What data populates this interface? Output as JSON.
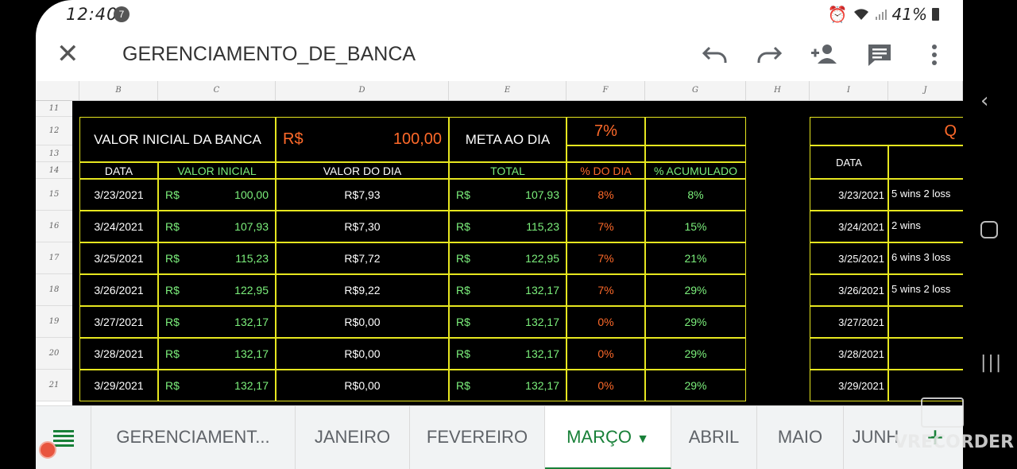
{
  "status": {
    "time": "12:40",
    "notif_count": "7",
    "battery": "41%"
  },
  "appbar": {
    "title": "GERENCIAMENTO_DE_BANCA"
  },
  "icons": {
    "close": "close-icon",
    "undo": "undo-icon",
    "redo": "redo-icon",
    "share": "add-person-icon",
    "comment": "comment-icon",
    "more": "more-vert-icon"
  },
  "columns": [
    "B",
    "C",
    "D",
    "E",
    "F",
    "G",
    "H",
    "I",
    "J"
  ],
  "rows": [
    "11",
    "12",
    "13",
    "14",
    "15",
    "16",
    "17",
    "18",
    "19",
    "20",
    "21"
  ],
  "summary": {
    "label": "VALOR INICIAL DA BANCA",
    "currency": "R$",
    "amount": "100,00",
    "meta_label": "META AO DIA",
    "meta_value": "7%"
  },
  "headers": {
    "data": "DATA",
    "valor_inicial": "VALOR INICIAL",
    "valor_dia": "VALOR DO DIA",
    "total": "TOTAL",
    "pct_dia": "% DO DIA",
    "pct_acum": "% ACUMULADO"
  },
  "table": [
    {
      "date": "3/23/2021",
      "cur": "R$",
      "inicial": "100,00",
      "dia": "R$7,93",
      "cur2": "R$",
      "total": "107,93",
      "pct": "8%",
      "acum": "8%"
    },
    {
      "date": "3/24/2021",
      "cur": "R$",
      "inicial": "107,93",
      "dia": "R$7,30",
      "cur2": "R$",
      "total": "115,23",
      "pct": "7%",
      "acum": "15%"
    },
    {
      "date": "3/25/2021",
      "cur": "R$",
      "inicial": "115,23",
      "dia": "R$7,72",
      "cur2": "R$",
      "total": "122,95",
      "pct": "7%",
      "acum": "21%"
    },
    {
      "date": "3/26/2021",
      "cur": "R$",
      "inicial": "122,95",
      "dia": "R$9,22",
      "cur2": "R$",
      "total": "132,17",
      "pct": "7%",
      "acum": "29%"
    },
    {
      "date": "3/27/2021",
      "cur": "R$",
      "inicial": "132,17",
      "dia": "R$0,00",
      "cur2": "R$",
      "total": "132,17",
      "pct": "0%",
      "acum": "29%"
    },
    {
      "date": "3/28/2021",
      "cur": "R$",
      "inicial": "132,17",
      "dia": "R$0,00",
      "cur2": "R$",
      "total": "132,17",
      "pct": "0%",
      "acum": "29%"
    },
    {
      "date": "3/29/2021",
      "cur": "R$",
      "inicial": "132,17",
      "dia": "R$0,00",
      "cur2": "R$",
      "total": "132,17",
      "pct": "0%",
      "acum": "29%"
    }
  ],
  "side": {
    "header_partial": "Q",
    "data_label": "DATA",
    "rows": [
      {
        "date": "3/23/2021",
        "note": "5 wins 2 loss"
      },
      {
        "date": "3/24/2021",
        "note": "2 wins"
      },
      {
        "date": "3/25/2021",
        "note": "6 wins 3 loss"
      },
      {
        "date": "3/26/2021",
        "note": "5 wins 2 loss"
      },
      {
        "date": "3/27/2021",
        "note": ""
      },
      {
        "date": "3/28/2021",
        "note": ""
      },
      {
        "date": "3/29/2021",
        "note": ""
      }
    ]
  },
  "tabs": [
    "GERENCIAMENT...",
    "JANEIRO",
    "FEVEREIRO",
    "MARÇO",
    "ABRIL",
    "MAIO",
    "JUNH"
  ],
  "active_tab": "MARÇO",
  "watermark": "VRECORDER",
  "colors": {
    "grid": "#e6e61f",
    "green": "#7cf07c",
    "orange": "#ff6a2a",
    "active_tab": "#188038"
  }
}
